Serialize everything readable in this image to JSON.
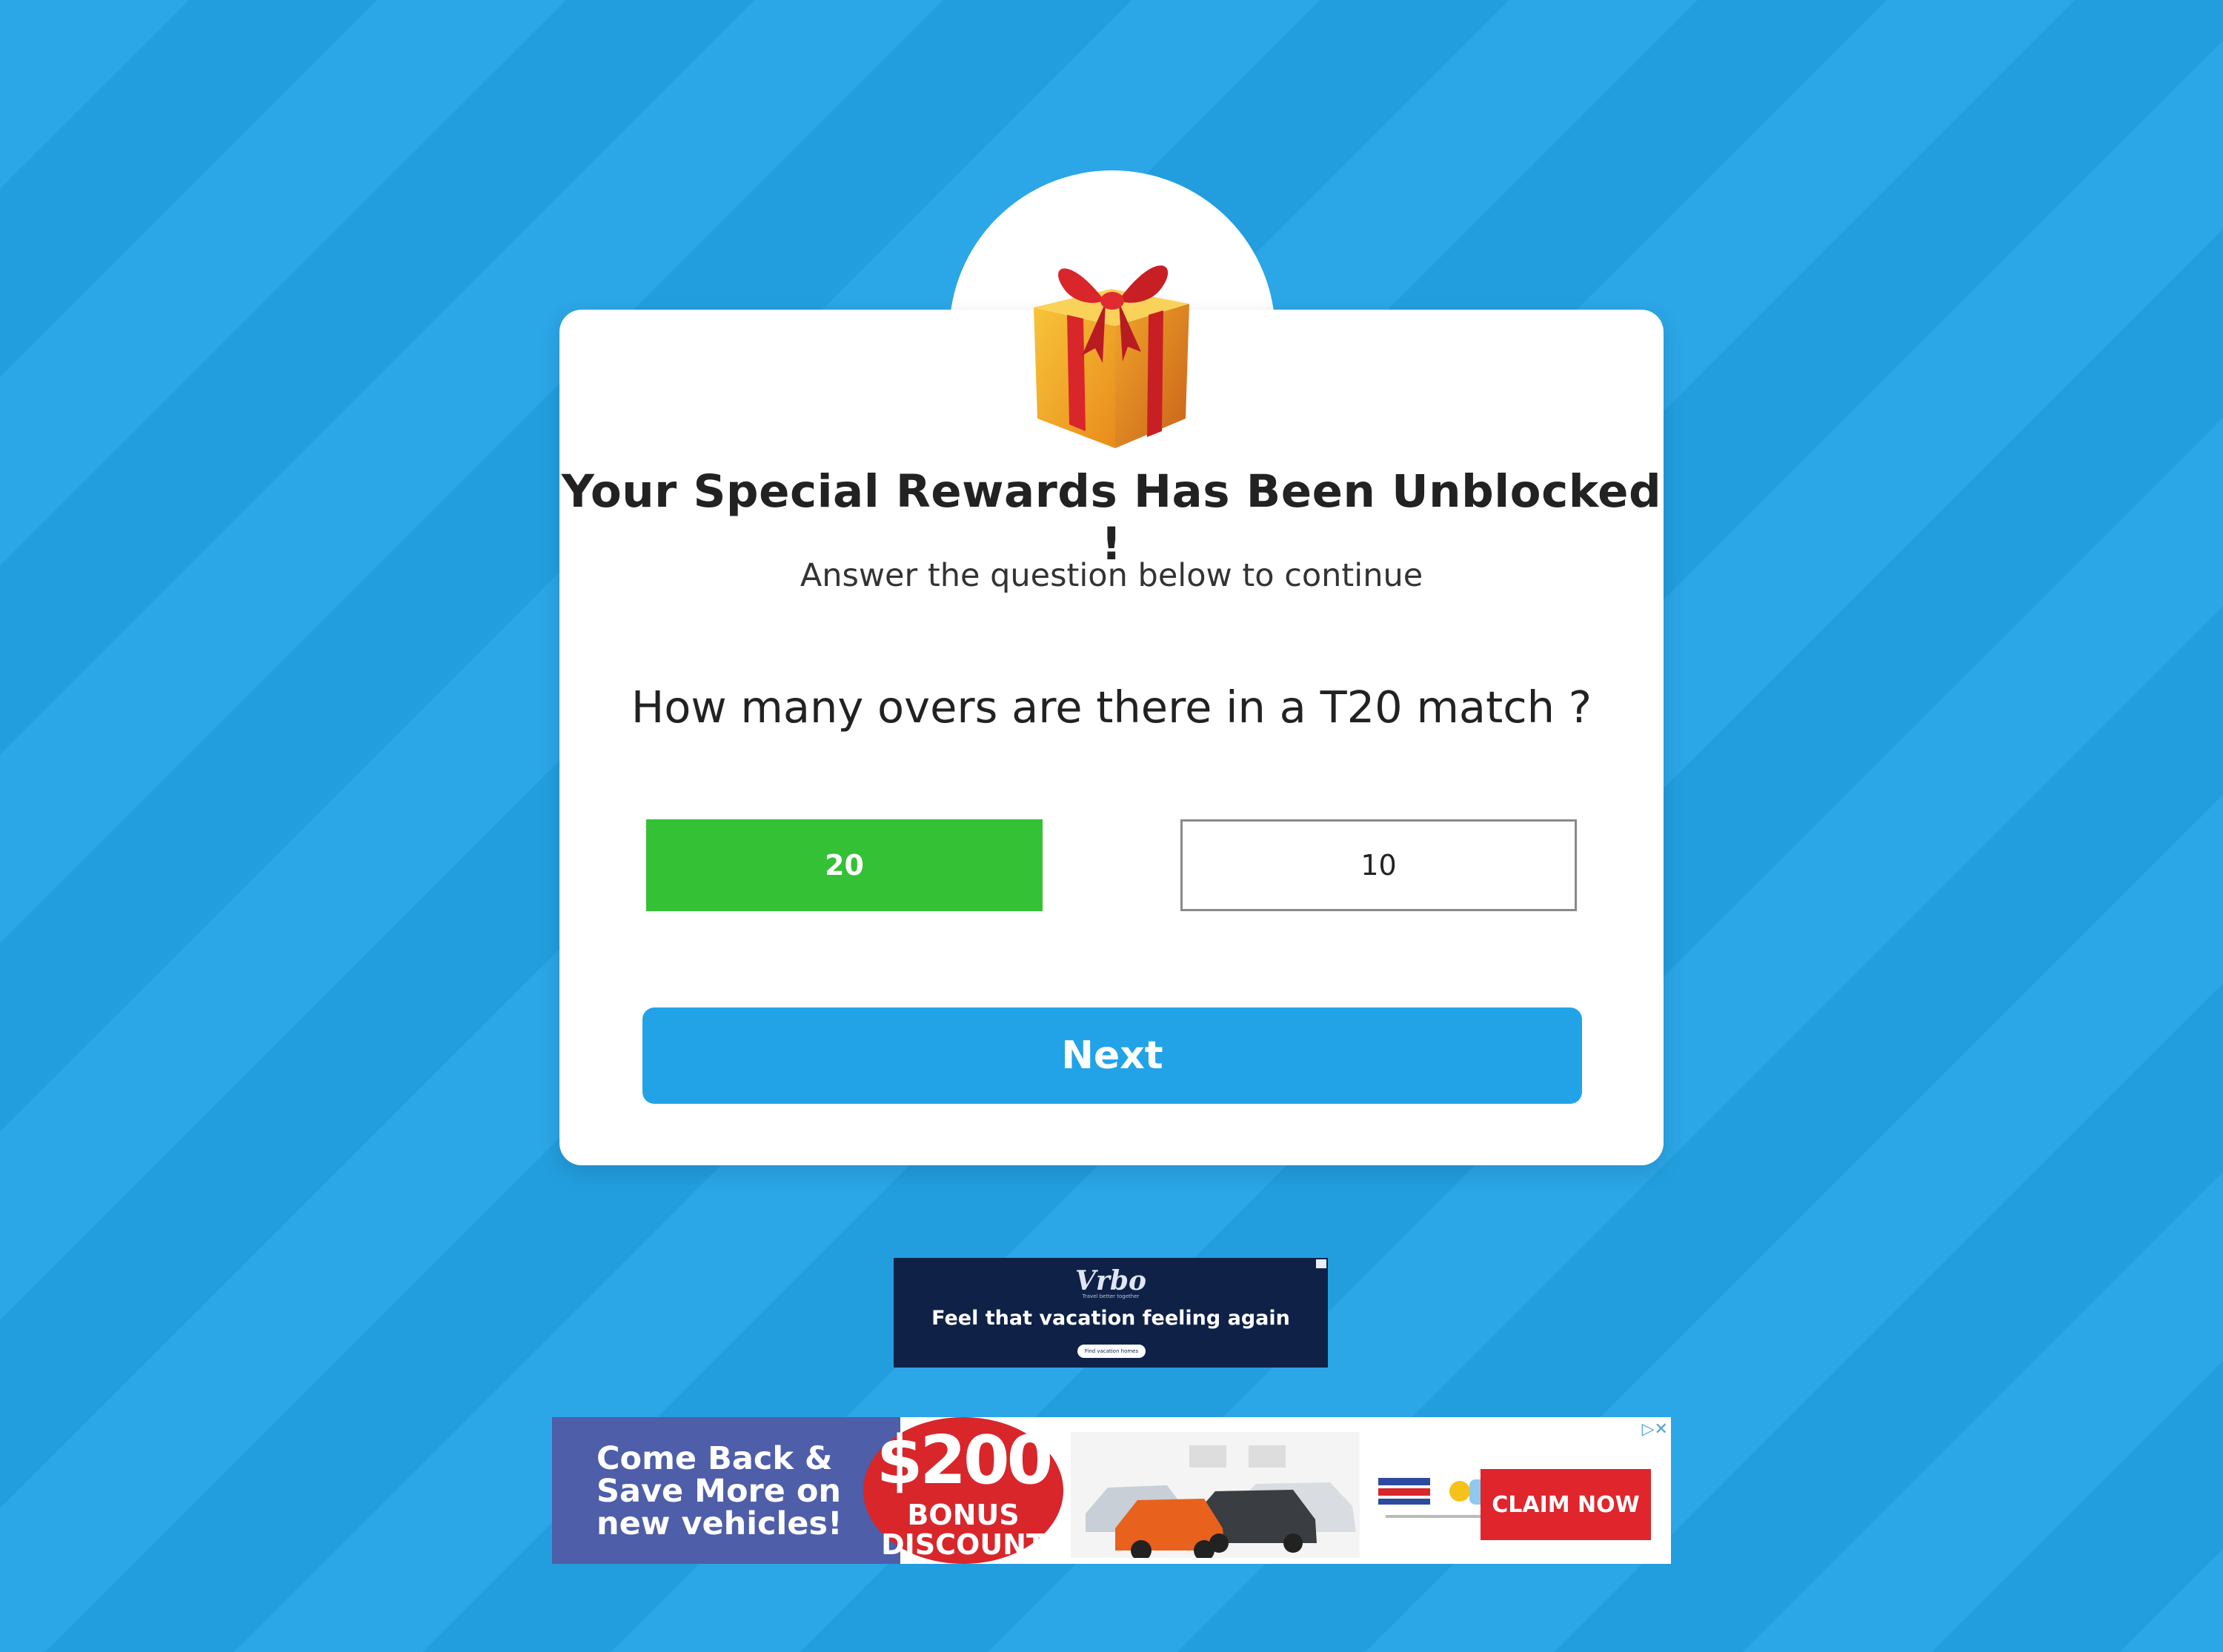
{
  "card": {
    "title": "Your Special Rewards Has Been Unblocked !",
    "subtitle": "Answer the question below to continue",
    "question": "How many overs are there in a T20 match ?",
    "options": [
      "20",
      "10"
    ],
    "next_label": "Next"
  },
  "ads": {
    "ad1": {
      "logo": "Vrbo",
      "tagline": "Travel better together",
      "headline": "Feel that vacation feeling again",
      "button": "Find vacation homes"
    },
    "ad2": {
      "line1": "Come Back &",
      "line2": "Save More on",
      "line3": "new vehicles!",
      "amount": "$200",
      "badge1": "BONUS",
      "badge2": "DISCOUNT",
      "cta": "CLAIM NOW",
      "close": "▷✕"
    }
  },
  "colors": {
    "background": "#23a3e6",
    "selected_option": "#35c135",
    "next_button": "#22a3e8",
    "cta": "#e0252c"
  },
  "icons": {
    "gift": "gift-box-icon"
  }
}
